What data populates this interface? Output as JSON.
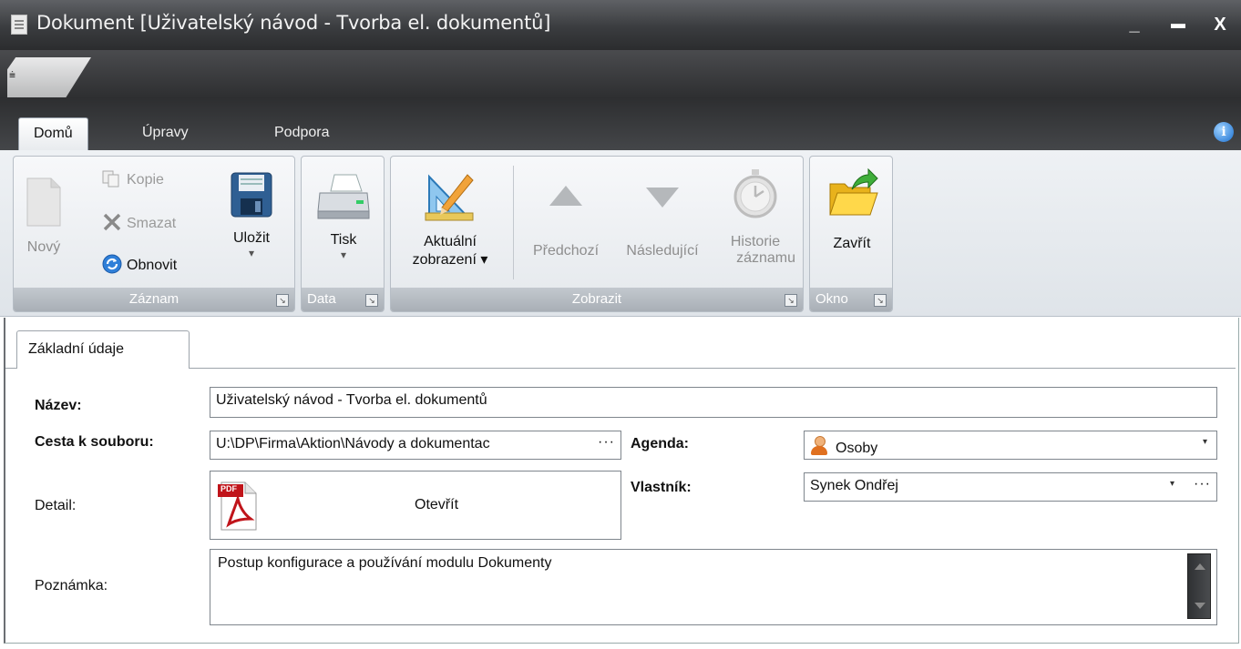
{
  "window": {
    "title": "Dokument [Uživatelský návod - Tvorba el. dokumentů]",
    "minimize": "_",
    "maximize": "▬",
    "close": "X"
  },
  "qat": {
    "customize_glyph": "⩧"
  },
  "tabs": [
    {
      "label": "Domů",
      "active": true
    },
    {
      "label": "Úpravy",
      "active": false
    },
    {
      "label": "Podpora",
      "active": false
    }
  ],
  "info_icon": "i",
  "ribbon": {
    "groups": {
      "zaznam": {
        "label": "Záznam",
        "novy": "Nový",
        "kopie": "Kopie",
        "smazat": "Smazat",
        "obnovit": "Obnovit",
        "ulozit": "Uložit",
        "ulozit_arrow": "▾"
      },
      "data": {
        "label": "Data",
        "tisk": "Tisk",
        "tisk_arrow": "▾"
      },
      "zobrazit": {
        "label": "Zobrazit",
        "aktualni_1": "Aktuální",
        "aktualni_2": "zobrazení ▾",
        "predchozi": "Předchozí",
        "nasledujici": "Následující",
        "historie_1": "Historie",
        "historie_2": "záznamu"
      },
      "okno": {
        "label": "Okno",
        "zavrit": "Zavřít"
      }
    },
    "launcher_glyph": "↘"
  },
  "form": {
    "tab_label": "Základní údaje",
    "nazev_label": "Název:",
    "nazev_value": "Uživatelský návod - Tvorba el. dokumentů",
    "cesta_label": "Cesta k souboru:",
    "cesta_value": "U:\\DP\\Firma\\Aktion\\Návody a dokumentac",
    "cesta_dots": "···",
    "agenda_label": "Agenda:",
    "agenda_value": "Osoby",
    "detail_label": "Detail:",
    "otevrit_label": "Otevřít",
    "pdf_badge": "PDF",
    "vlastnik_label": "Vlastník:",
    "vlastnik_value": "Synek Ondřej",
    "vlastnik_dots": "···",
    "dropdown_arrow": "▾",
    "poznamka_label": "Poznámka:",
    "poznamka_value": "Postup konfigurace a používání modulu Dokumenty"
  },
  "colors": {
    "titlebar": "#3a3c3f",
    "ribbon_bg": "#e4e8ec",
    "group_label_bg": "#b0b6bd",
    "accent_blue": "#1a6fd0"
  }
}
